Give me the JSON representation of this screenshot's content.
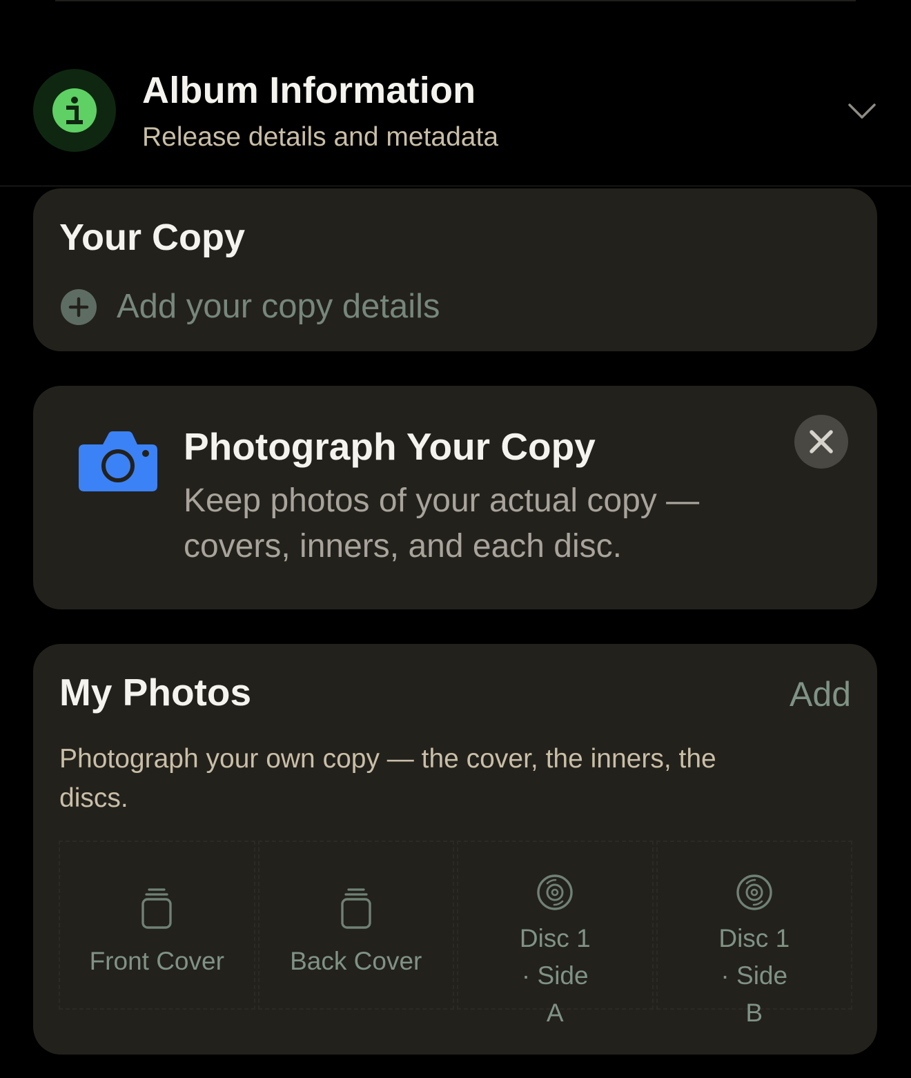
{
  "header": {
    "title": "Album Information",
    "subtitle": "Release details and metadata",
    "icon": "info-icon",
    "toggle_icon": "chevron-down-icon"
  },
  "your_copy": {
    "title": "Your Copy",
    "add_label": "Add your copy details",
    "add_icon": "plus-circle-icon"
  },
  "photograph_prompt": {
    "title": "Photograph Your Copy",
    "text": "Keep photos of your actual copy — covers, inners, and each disc.",
    "icon": "camera-icon",
    "dismiss_icon": "close-icon"
  },
  "my_photos": {
    "title": "My Photos",
    "add_label": "Add",
    "description": "Photograph your own copy — the cover, the inners, the discs.",
    "slots": [
      {
        "label": "Front Cover",
        "icon": "sleeve-icon"
      },
      {
        "label": "Back Cover",
        "icon": "sleeve-icon"
      },
      {
        "label": "Disc 1 · Side A",
        "icon": "disc-icon"
      },
      {
        "label": "Disc 1 · Side B",
        "icon": "disc-icon"
      }
    ]
  },
  "colors": {
    "background": "#000000",
    "card": "#23211c",
    "accent_green": "#5fd064",
    "accent_blue": "#3b82f6",
    "muted_green": "#7f9385",
    "subtitle_tan": "#c9bfa7"
  }
}
